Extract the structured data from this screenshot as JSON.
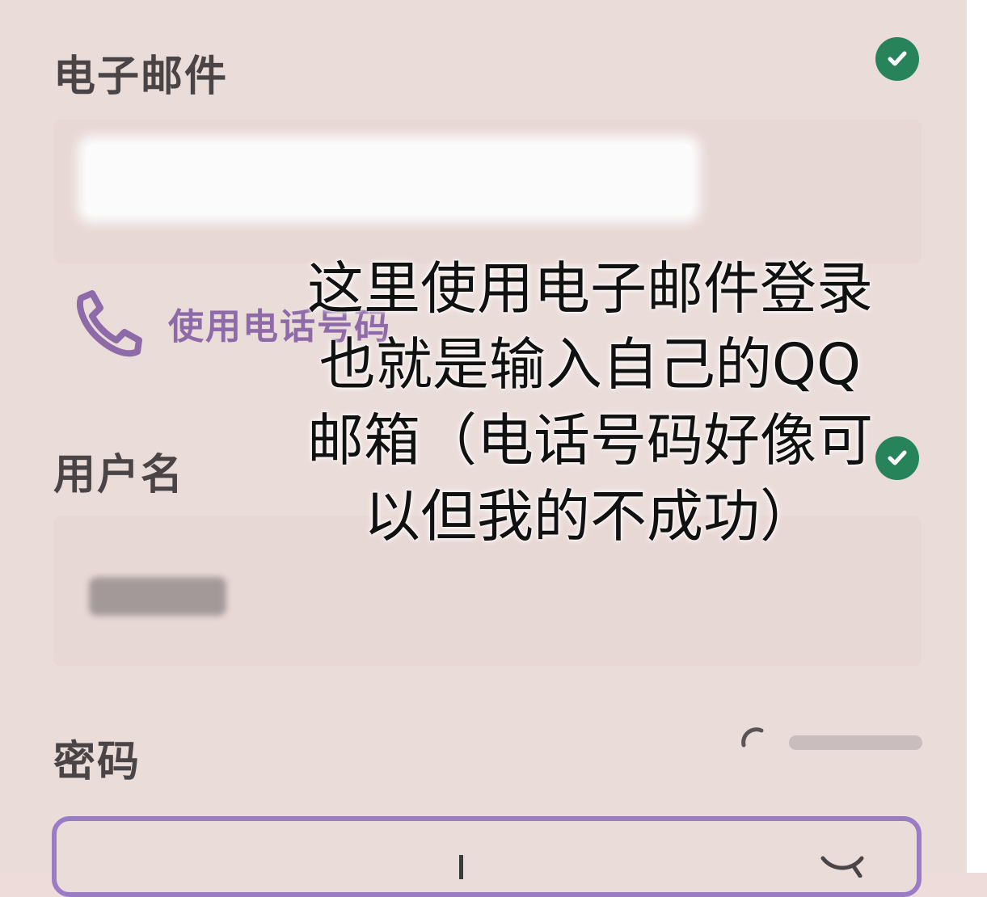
{
  "email": {
    "label": "电子邮件",
    "status_icon": "check-circle-icon",
    "value_redacted": true
  },
  "phone_link": {
    "icon": "phone-icon",
    "label": "使用电话号码"
  },
  "username": {
    "label": "用户名",
    "status_icon": "check-circle-icon",
    "value_redacted": true
  },
  "password": {
    "label": "密码",
    "visibility_icon": "eye-off-icon"
  },
  "annotation": {
    "lines": [
      "这里使用电子邮件登录",
      "也就是输入自己的QQ",
      "邮箱（电话号码好像可",
      "以但我的不成功）"
    ]
  },
  "colors": {
    "background": "#eadcd9",
    "check_green": "#27835a",
    "accent_purple": "#9a7cc4",
    "label_gray": "#4b4446"
  }
}
